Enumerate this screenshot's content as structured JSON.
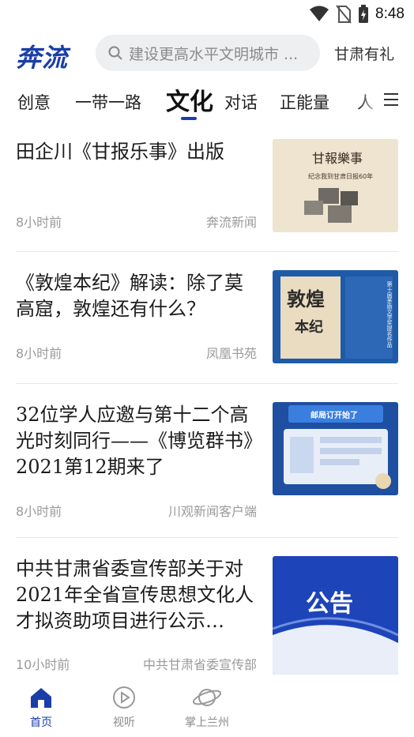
{
  "status_bar": {
    "time": "8:48",
    "icons": [
      "wifi-icon",
      "no-sim-icon",
      "battery-charging-icon"
    ]
  },
  "header": {
    "logo": "奔流",
    "search_placeholder": "建设更高水平文明城市 ...",
    "right_text": "甘肃有礼"
  },
  "tabs": {
    "items": [
      "创意",
      "一带一路",
      "文化",
      "对话",
      "正能量",
      "人"
    ],
    "active": "文化"
  },
  "news": [
    {
      "title": "田企川《甘报乐事》出版",
      "time": "8小时前",
      "source": "奔流新闻",
      "thumb_lines": [
        "甘報樂事",
        "纪念我到甘肃日报60年"
      ]
    },
    {
      "title": "《敦煌本纪》解读：除了莫高窟，敦煌还有什么？",
      "time": "8小时前",
      "source": "凤凰书苑",
      "thumb_lines": [
        "敦煌",
        "本纪",
        "第十届茅盾文学奖提名作品"
      ]
    },
    {
      "title": "32位学人应邀与第十二个高光时刻同行——《博览群书》2021第12期来了",
      "time": "8小时前",
      "source": "川观新闻客户端",
      "thumb_lines": [
        "邮局订开始了"
      ]
    },
    {
      "title": "中共甘肃省委宣传部关于对2021年全省宣传思想文化人才拟资助项目进行公示…",
      "time": "10小时前",
      "source": "中共甘肃省委宣传部",
      "thumb_lines": [
        "公告"
      ]
    }
  ],
  "bottom_nav": [
    {
      "label": "首页",
      "icon": "home-icon",
      "active": true
    },
    {
      "label": "视听",
      "icon": "play-circle-icon",
      "active": false
    },
    {
      "label": "掌上兰州",
      "icon": "planet-icon",
      "active": false
    }
  ],
  "colors": {
    "brand": "#1a3ea8",
    "meta": "#9a9a9a",
    "search_bg": "#eeeff1"
  }
}
